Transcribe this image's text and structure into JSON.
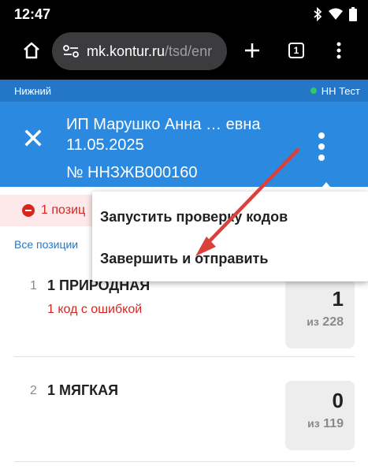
{
  "status_bar": {
    "time": "12:47"
  },
  "browser": {
    "url_host": "mk.kontur.ru",
    "url_path": "/tsd/enr",
    "tabs_count": "1"
  },
  "app": {
    "location": "Нижний",
    "environment": "НН Тест",
    "environment_color": "#2fc86a"
  },
  "document": {
    "title_line1": "ИП Марушко Анна … евна",
    "title_line2": "11.05.2025",
    "number": "№ ННЗЖВ000160"
  },
  "error_banner": {
    "text": "1 позиц"
  },
  "filter": {
    "label": "Все позиции"
  },
  "items": [
    {
      "num": "1",
      "name": "1 ПРИРОДНАЯ",
      "error": "1 код с ошибкой",
      "count": "1",
      "of_label": "из",
      "total": "228"
    },
    {
      "num": "2",
      "name": "1 МЯГКАЯ",
      "error": "",
      "count": "0",
      "of_label": "из",
      "total": "119"
    }
  ],
  "menu": {
    "items": [
      {
        "label": "Запустить проверку кодов"
      },
      {
        "label": "Завершить и отправить"
      }
    ]
  },
  "annotation": {
    "arrow_color": "#d9413a"
  }
}
